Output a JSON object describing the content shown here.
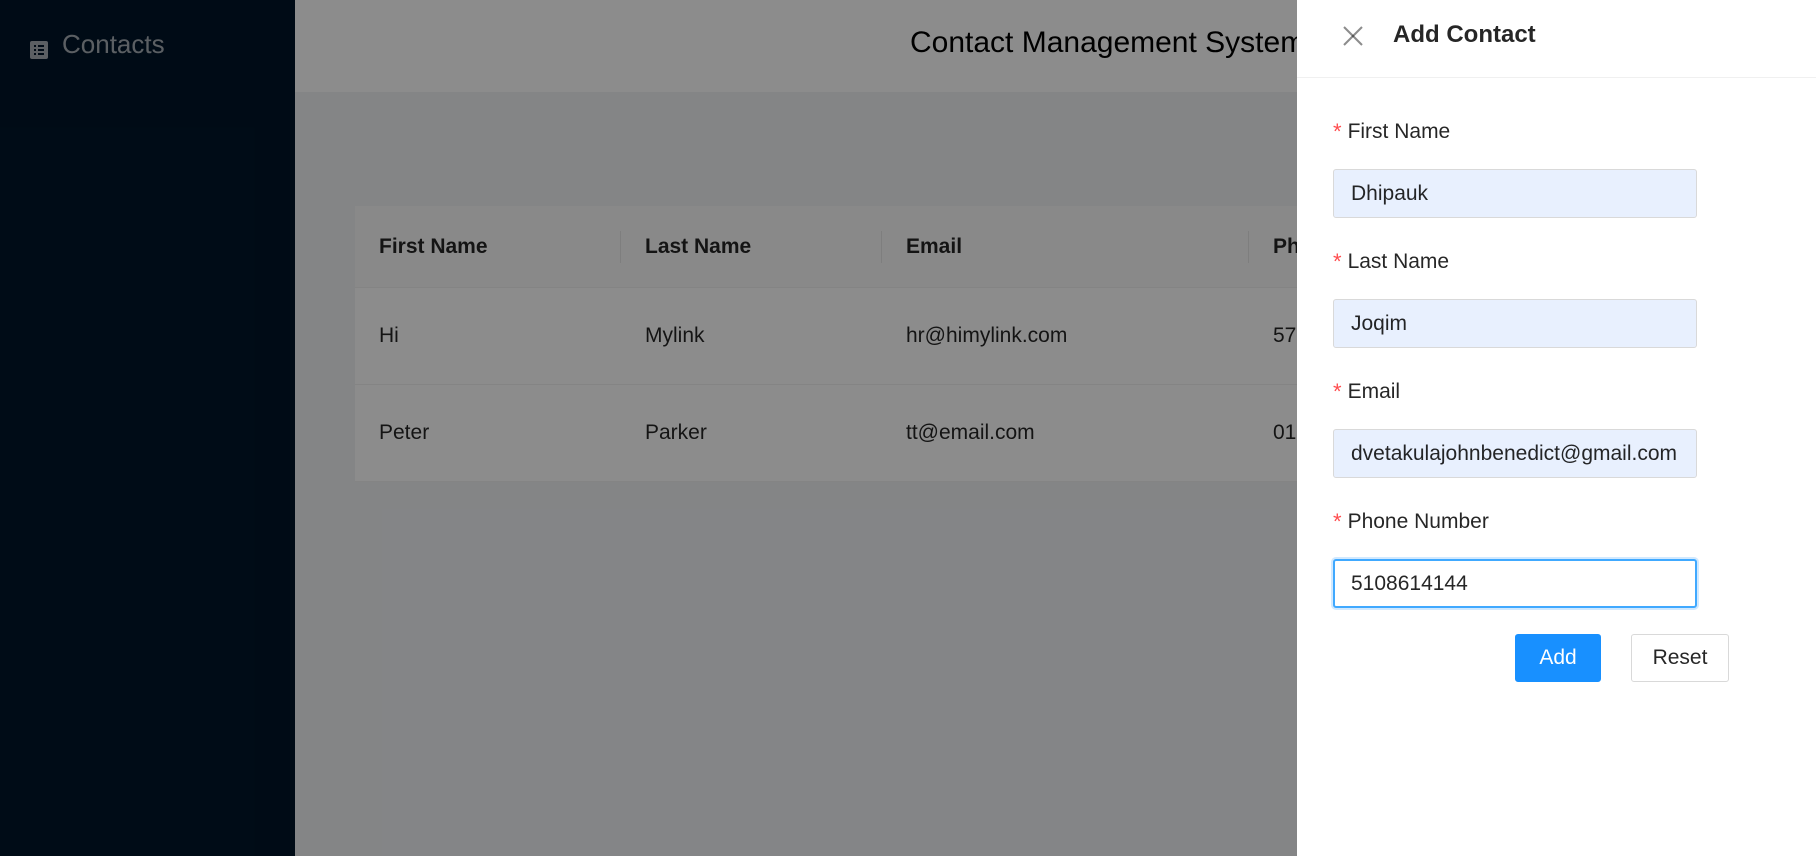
{
  "sidebar": {
    "items": [
      {
        "label": "Contacts",
        "icon": "list-icon"
      }
    ]
  },
  "header": {
    "title": "Contact Management System"
  },
  "table": {
    "columns": [
      "First Name",
      "Last Name",
      "Email",
      "Ph"
    ],
    "rows": [
      {
        "first_name": "Hi",
        "last_name": "Mylink",
        "email": "hr@himylink.com",
        "phone": "57"
      },
      {
        "first_name": "Peter",
        "last_name": "Parker",
        "email": "tt@email.com",
        "phone": "01"
      }
    ]
  },
  "drawer": {
    "title": "Add Contact",
    "close_icon": "close-icon",
    "fields": [
      {
        "label": "First Name",
        "value": "Dhipauk",
        "required": true
      },
      {
        "label": "Last Name",
        "value": "Joqim",
        "required": true
      },
      {
        "label": "Email",
        "value": "dvetakulajohnbenedict@gmail.com",
        "required": true
      },
      {
        "label": "Phone Number",
        "value": "5108614144",
        "required": true,
        "focused": true
      }
    ],
    "buttons": {
      "add": "Add",
      "reset": "Reset"
    },
    "required_mark": "*"
  },
  "colors": {
    "sidebar_bg": "#001529",
    "primary": "#1890ff",
    "required": "#ff4d4f",
    "autofill_bg": "#e8f0fe"
  }
}
